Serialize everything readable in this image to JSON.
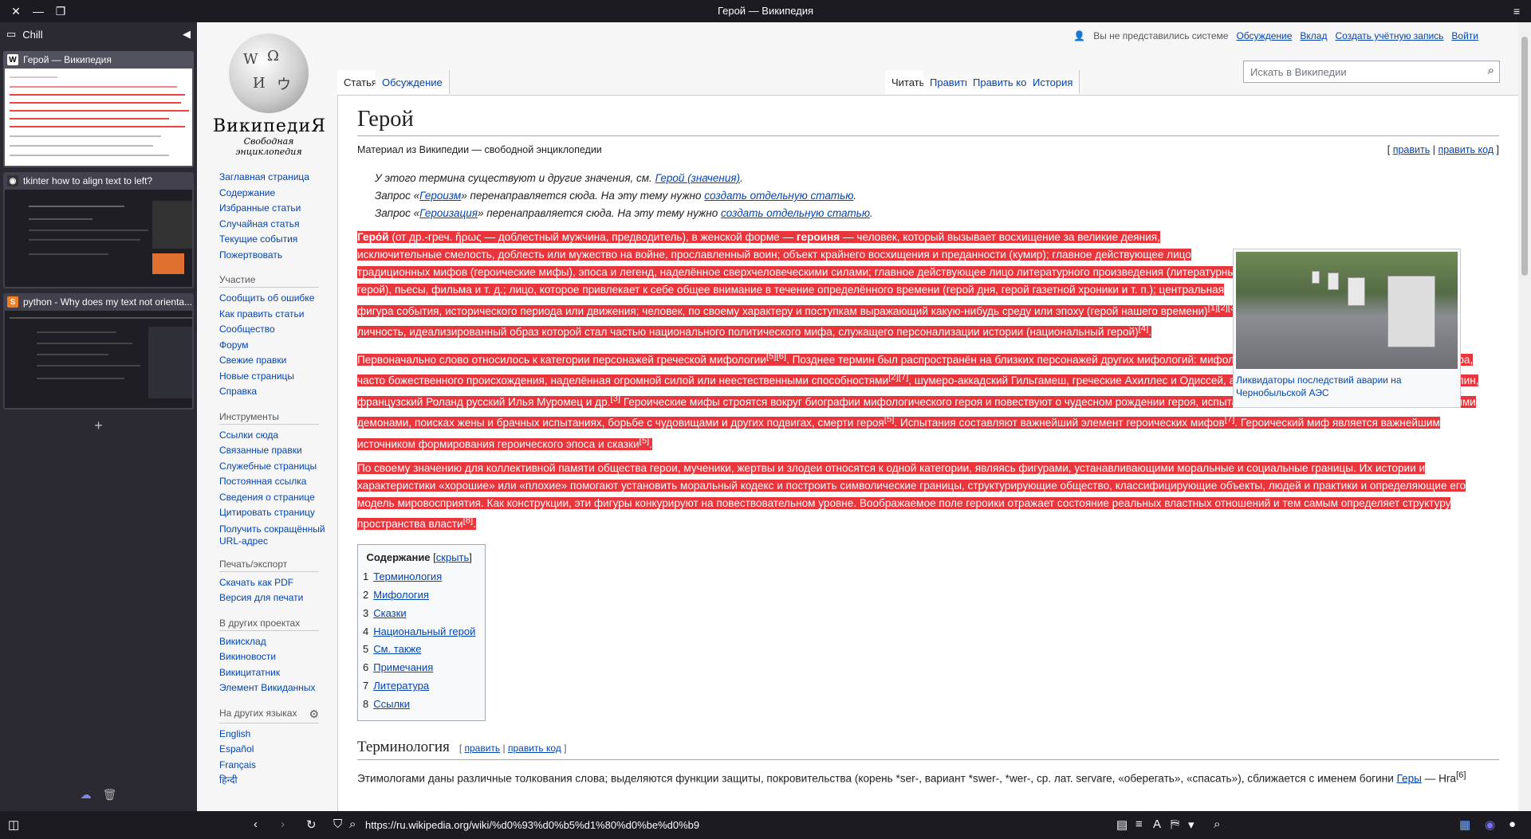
{
  "window": {
    "title": "Герой — Википедия",
    "close_icon": "close-icon",
    "min_icon": "minimize-icon",
    "restore_icon": "restore-icon",
    "menu_icon": "hamburger-menu-icon"
  },
  "sidebar": {
    "workspace": "Chill",
    "tabs": [
      {
        "title": "Герой — Википедия",
        "favicon": "W",
        "active": true
      },
      {
        "title": "tkinter how to align text to left?",
        "favicon": "◉",
        "active": false
      },
      {
        "title": "python - Why does my text not orienta...",
        "favicon": "S",
        "active": false
      }
    ],
    "add_label": "+"
  },
  "wiki": {
    "logo_wordmark": "ВикипедиЯ",
    "logo_tagline": "Свободная энциклопедия",
    "nav_main": [
      "Заглавная страница",
      "Содержание",
      "Избранные статьи",
      "Случайная статья",
      "Текущие события",
      "Пожертвовать"
    ],
    "portal_participation": {
      "title": "Участие",
      "items": [
        "Сообщить об ошибке",
        "Как править статьи",
        "Сообщество",
        "Форум",
        "Свежие правки",
        "Новые страницы",
        "Справка"
      ]
    },
    "portal_tools": {
      "title": "Инструменты",
      "items": [
        "Ссылки сюда",
        "Связанные правки",
        "Служебные страницы",
        "Постоянная ссылка",
        "Сведения о странице",
        "Цитировать страницу",
        "Получить сокращённый URL-адрес"
      ]
    },
    "portal_print": {
      "title": "Печать/экспорт",
      "items": [
        "Скачать как PDF",
        "Версия для печати"
      ]
    },
    "portal_projects": {
      "title": "В других проектах",
      "items": [
        "Викисклад",
        "Викиновости",
        "Викицитатник",
        "Элемент Викиданных"
      ]
    },
    "portal_langs": {
      "title": "На других языках",
      "items": [
        "English",
        "Español",
        "Français",
        "हिन्दी"
      ]
    },
    "personal": {
      "anon": "Вы не представились системе",
      "talk": "Обсуждение",
      "contribs": "Вклад",
      "create": "Создать учётную запись",
      "login": "Войти"
    },
    "tabs_left": [
      "Статья",
      "Обсуждение"
    ],
    "tabs_right": [
      "Читать",
      "Править",
      "Править код",
      "История"
    ],
    "search_placeholder": "Искать в Википедии"
  },
  "article": {
    "title": "Герой",
    "sitesub": "Материал из Википедии — свободной энциклопедии",
    "edit_links": [
      "править",
      "править код"
    ],
    "hatnotes": [
      {
        "pre": "У этого термина существуют и другие значения, см. ",
        "link": "Герой (значения)",
        "post": "."
      },
      {
        "pre": "Запрос «",
        "link": "Героизм",
        "mid": "» перенаправляется сюда. На эту тему нужно ",
        "link2": "создать отдельную статью",
        "post": "."
      },
      {
        "pre": "Запрос «",
        "link": "Героизация",
        "mid": "» перенаправляется сюда. На эту тему нужно ",
        "link2": "создать отдельную статью",
        "post": "."
      }
    ],
    "p1_bold": "Геро́й",
    "p1_a": " (от др.-греч. ἥρως — доблестный мужчина, предводитель), в женской форме — ",
    "p1_bold2": "героиня",
    "p1_b": " — человек, который вызывает восхищение за великие деяния, исключительные смелость, доблесть или мужество на войне, прославленный воин; объект крайнего восхищения и преданности (кумир); главное действующее лицо традиционных мифов (героические мифы), эпоса и легенд, наделённое сверхчеловеческими силами; главное действующее лицо литературного произведения (литературный герой), пьесы, фильма и т. д.; лицо, которое привлекает к себе общее внимание в течение определённого времени (герой дня, герой газетной хроники и т. п.); центральная фигура события, исторического периода или движения; человек, по своему характеру и поступкам выражающий какую-нибудь среду или эпоху (герой нашего времени)",
    "p1_ref1": "[1][2][3]",
    "p1_c": "; личность, идеализированный образ которой стал частью национального политического мифа, служащего персонализации истории (национальный герой)",
    "p1_ref2": "[4]",
    "p1_d": ".",
    "p2_a": "Первоначально слово относилось к категории персонажей греческой мифологии",
    "p2_ref1": "[5][6]",
    "p2_b": ". Позднее термин был распространён на близких персонажей других мифологий: мифологическая, эпическая или легендарная фигура, часто божественного происхождения, наделённая огромной силой или неестественными способностями",
    "p2_ref2": "[2][7]",
    "p2_c": ", шумеро-аккадский Гильгамеш, греческие Ахиллес и Одиссей, англосаксонский Беовульф, ирландский Кухулин, французский Роланд русский Илья Муромец и др.",
    "p2_ref3": "[3]",
    "p2_d": " Героические мифы строятся вокруг биографии мифологического героя и повествуют о чудесном рождении героя, испытании его старшими родичами или враждебными демонами, поисках жены и брачных испытаниях, борьбе с чудовищами и других подвигах, смерти героя",
    "p2_ref4": "[5]",
    "p2_e": ". Испытания составляют важнейший элемент героических мифов",
    "p2_ref5": "[7]",
    "p2_f": ". Героический миф является важнейшим источником формирования героического эпоса и сказки",
    "p2_ref6": "[5]",
    "p2_g": ".",
    "p3_a": "По своему значению для коллективной памяти общества герои, мученики, жертвы и злодеи относятся к одной категории, являясь фигурами, устанавливающими моральные и социальные границы. Их истории и характеристики «хорошие» или «плохие» помогают установить моральный кодекс и построить символические границы, структурирующие общество, классифицирующие объекты, людей и практики и определяющие его модель мировосприятия. Как конструкции, эти фигуры конкурируют на повествовательном уровне. Воображаемое поле героики отражает состояние реальных властных отношений и тем самым определяет структуру пространства власти",
    "p3_ref": "[8]",
    "p3_b": ".",
    "image_caption": "Ликвидаторы последствий аварии на Чернобыльской АЭС",
    "toc": {
      "title": "Содержание",
      "hide": "скрыть",
      "items": [
        {
          "num": "1",
          "label": "Терминология"
        },
        {
          "num": "2",
          "label": "Мифология"
        },
        {
          "num": "3",
          "label": "Сказки"
        },
        {
          "num": "4",
          "label": "Национальный герой"
        },
        {
          "num": "5",
          "label": "См. также"
        },
        {
          "num": "6",
          "label": "Примечания"
        },
        {
          "num": "7",
          "label": "Литература"
        },
        {
          "num": "8",
          "label": "Ссылки"
        }
      ]
    },
    "section1": {
      "title": "Терминология",
      "edit": "править",
      "edit_code": "править код"
    },
    "s1_text_a": "Этимологами даны различные толкования слова; выделяются функции защиты, покровительства (корень *ser-, вариант *swer-, *wer-, ср. лат. servare, «оберегать», «спасать»), сближается с именем богини ",
    "s1_link": "Геры",
    "s1_text_b": " — Hra",
    "s1_ref": "[6]"
  },
  "toolbar": {
    "url": "https://ru.wikipedia.org/wiki/%d0%93%d0%b5%d1%80%d0%be%d0%b9"
  }
}
